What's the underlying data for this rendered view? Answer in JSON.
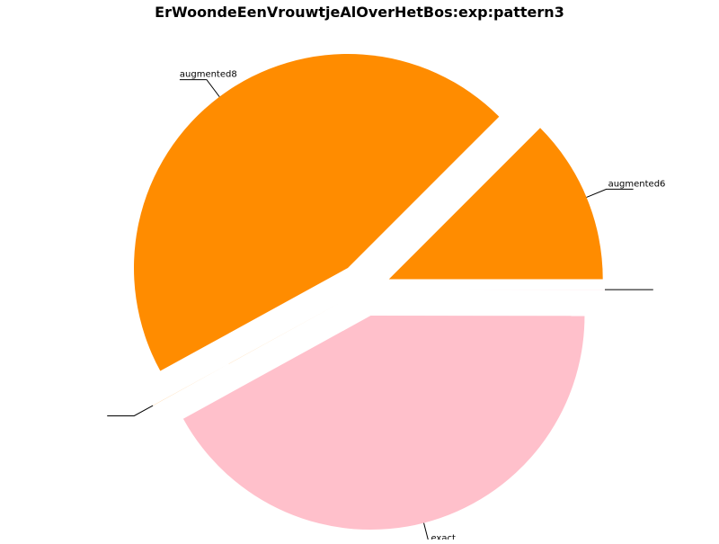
{
  "chart_data": {
    "type": "pie",
    "title": "ErWoondeEenVrouwtjeAlOverHetBos:exp:pattern3",
    "slices": [
      {
        "label": "augmented6",
        "value": 12.5,
        "color": "#FF8C00",
        "exploded": true
      },
      {
        "label": "augmented8",
        "value": 45.5,
        "color": "#FF8C00",
        "exploded": true
      },
      {
        "label": "",
        "value": 0.01,
        "color": "#FF8C00",
        "exploded": true
      },
      {
        "label": "exact",
        "value": 42.0,
        "color": "#FFC0CB",
        "exploded": true
      },
      {
        "label": "",
        "value": 0.01,
        "color": "#FFC0CB",
        "exploded": true
      }
    ],
    "start_angle_deg": 0,
    "direction": "counterclockwise",
    "legend": "none"
  }
}
